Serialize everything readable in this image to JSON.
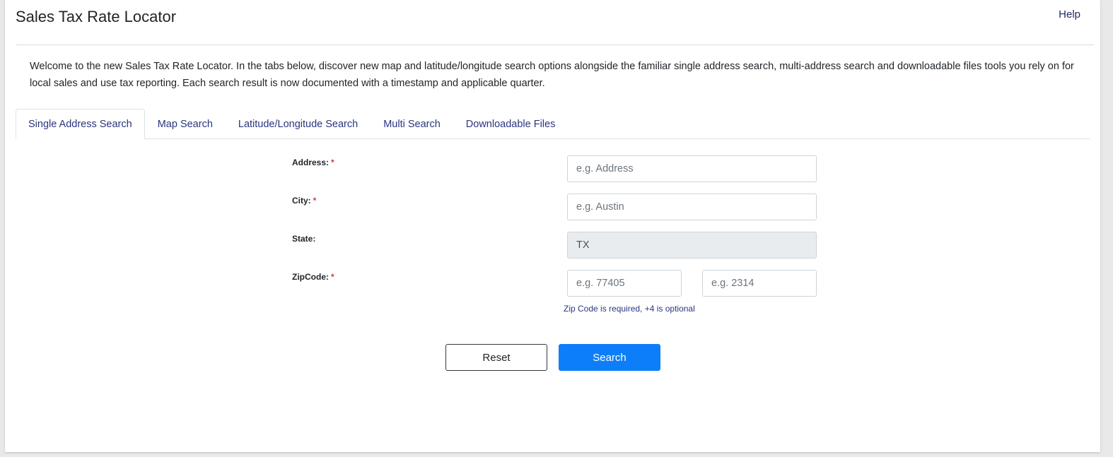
{
  "header": {
    "title": "Sales Tax Rate Locator",
    "help_label": "Help"
  },
  "intro_text": "Welcome to the new Sales Tax Rate Locator. In the tabs below, discover new map and latitude/longitude search options alongside the familiar single address search, multi-address search and downloadable files tools you rely on for local sales and use tax reporting. Each search result is now documented with a timestamp and applicable quarter.",
  "tabs": [
    {
      "label": "Single Address Search",
      "active": true
    },
    {
      "label": "Map Search",
      "active": false
    },
    {
      "label": "Latitude/Longitude Search",
      "active": false
    },
    {
      "label": "Multi Search",
      "active": false
    },
    {
      "label": "Downloadable Files",
      "active": false
    }
  ],
  "form": {
    "address": {
      "label": "Address:",
      "required_mark": "*",
      "value": "",
      "placeholder": "e.g. Address"
    },
    "city": {
      "label": "City:",
      "required_mark": "*",
      "value": "",
      "placeholder": "e.g. Austin"
    },
    "state": {
      "label": "State:",
      "value": "TX"
    },
    "zipcode": {
      "label": "ZipCode:",
      "required_mark": "*",
      "zip_placeholder": "e.g. 77405",
      "plus4_placeholder": "e.g. 2314",
      "hint": "Zip Code is required, +4 is optional"
    }
  },
  "buttons": {
    "reset_label": "Reset",
    "search_label": "Search"
  },
  "colors": {
    "primary": "#0d7ef9",
    "link": "#2a3580",
    "required": "#dc3545",
    "readonly_bg": "#e9ecef"
  }
}
